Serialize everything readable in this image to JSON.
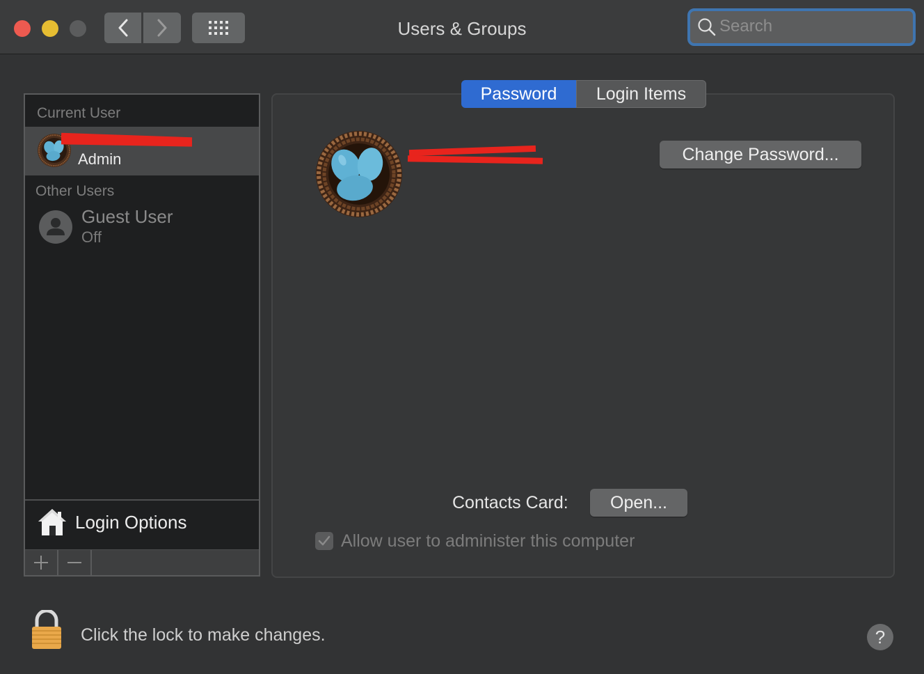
{
  "window": {
    "title": "Users & Groups"
  },
  "toolbar": {
    "back_icon": "chevron-left-icon",
    "forward_icon": "chevron-right-icon",
    "grid_icon": "grid-icon"
  },
  "search": {
    "placeholder": "Search",
    "value": ""
  },
  "sidebar": {
    "current_user_label": "Current User",
    "current_user": {
      "name": "",
      "role": "Admin"
    },
    "other_users_label": "Other Users",
    "guest": {
      "name": "Guest User",
      "status": "Off"
    },
    "login_options_label": "Login Options",
    "add_icon": "plus-icon",
    "remove_icon": "minus-icon"
  },
  "tabs": [
    {
      "label": "Password",
      "selected": true
    },
    {
      "label": "Login Items",
      "selected": false
    }
  ],
  "panel": {
    "user_name": "",
    "change_password_label": "Change Password...",
    "contacts_card_label": "Contacts Card:",
    "open_label": "Open...",
    "allow_admin_label": "Allow user to administer this computer",
    "allow_admin_checked": true
  },
  "footer": {
    "lock_text": "Click the lock to make changes.",
    "help_label": "?"
  },
  "colors": {
    "accent": "#2f6bd1",
    "redaction": "#e8241d",
    "close": "#ed5a50",
    "minimize": "#e6bd32"
  }
}
